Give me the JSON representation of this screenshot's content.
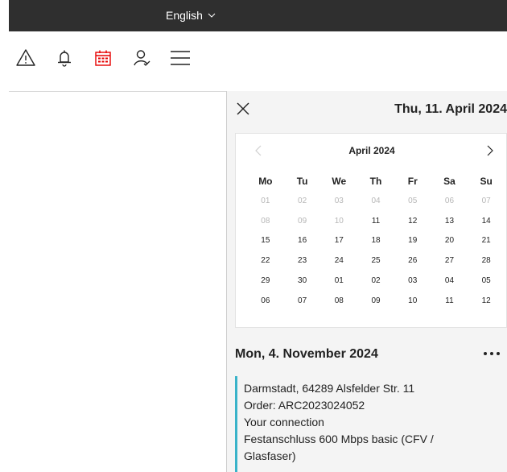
{
  "header": {
    "language": "English",
    "icons": [
      "warning-icon",
      "bell-icon",
      "calendar-icon",
      "user-icon",
      "menu-icon"
    ],
    "accent_color": "#e60000"
  },
  "panel": {
    "title": "Thu, 11. April 2024",
    "calendar": {
      "month": "April 2024",
      "weekdays": [
        "Mo",
        "Tu",
        "We",
        "Th",
        "Fr",
        "Sa",
        "Su"
      ],
      "weeks": [
        [
          "01",
          "02",
          "03",
          "04",
          "05",
          "06",
          "07"
        ],
        [
          "08",
          "09",
          "10",
          "11",
          "12",
          "13",
          "14"
        ],
        [
          "15",
          "16",
          "17",
          "18",
          "19",
          "20",
          "21"
        ],
        [
          "22",
          "23",
          "24",
          "25",
          "26",
          "27",
          "28"
        ],
        [
          "29",
          "30",
          "01",
          "02",
          "03",
          "04",
          "05"
        ],
        [
          "06",
          "07",
          "08",
          "09",
          "10",
          "11",
          "12"
        ]
      ]
    },
    "day_heading": "Mon, 4. November 2024",
    "order": {
      "address": "Darmstadt, 64289 Alsfelder Str. 11",
      "order_number": "Order: ARC2023024052",
      "connection_label": "Your connection",
      "product_line1": "Festanschluss 600 Mbps basic (CFV /",
      "product_line2": "Glasfaser)",
      "accent_color": "#39b3c9"
    }
  }
}
